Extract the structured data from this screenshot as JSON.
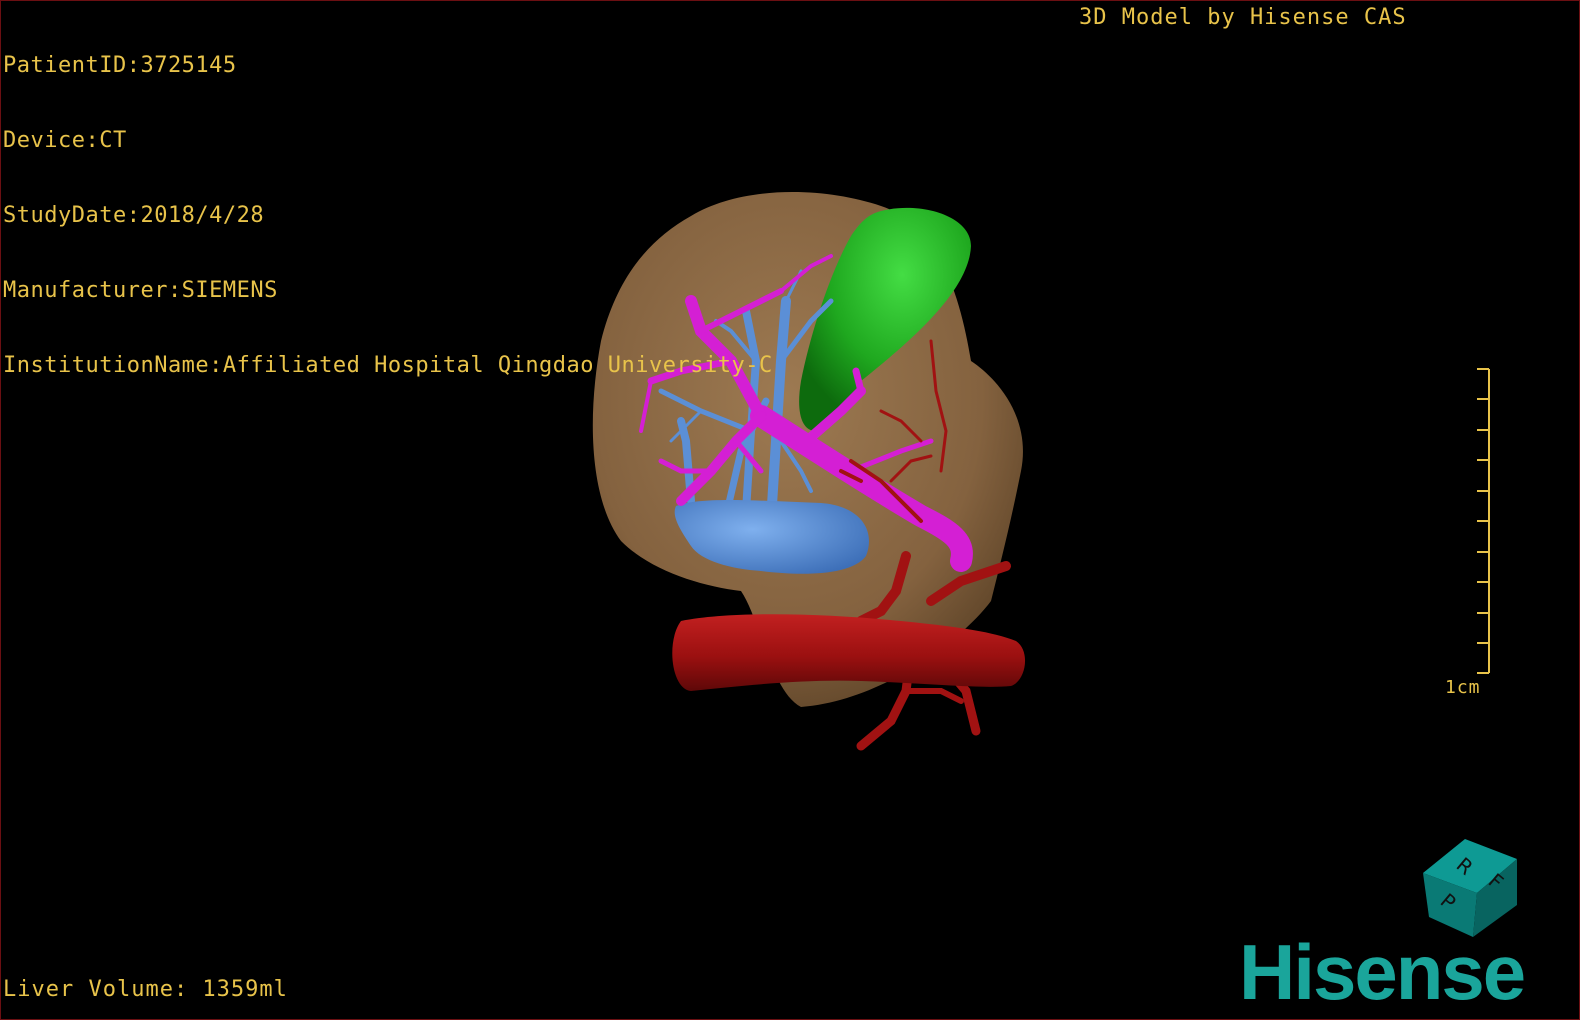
{
  "patient_info": {
    "patient_id": "PatientID:3725145",
    "device": "Device:CT",
    "study_date": "StudyDate:2018/4/28",
    "manufacturer": "Manufacturer:SIEMENS",
    "institution": "InstitutionName:Affiliated Hospital Qingdao University-C"
  },
  "credit": "3D Model by Hisense CAS",
  "liver_volume": "Liver Volume: 1359ml",
  "scale_bar": {
    "label": "1cm"
  },
  "orientation_cube": {
    "labels": [
      "R",
      "F",
      "P"
    ],
    "color": "#0f8f8a"
  },
  "logo": {
    "text": "Hisense",
    "color": "#1aa59b"
  },
  "colors": {
    "text": "#e8c34a",
    "liver": "#8a6844",
    "gallbladder": "#22a922",
    "portal_vein": "#d41fd4",
    "hepatic_vein": "#5b8fd6",
    "artery": "#9e1010",
    "border": "#6b0f12"
  },
  "model_parts": [
    "liver-surface",
    "gallbladder",
    "portal-vein",
    "hepatic-vein",
    "artery-aorta"
  ]
}
